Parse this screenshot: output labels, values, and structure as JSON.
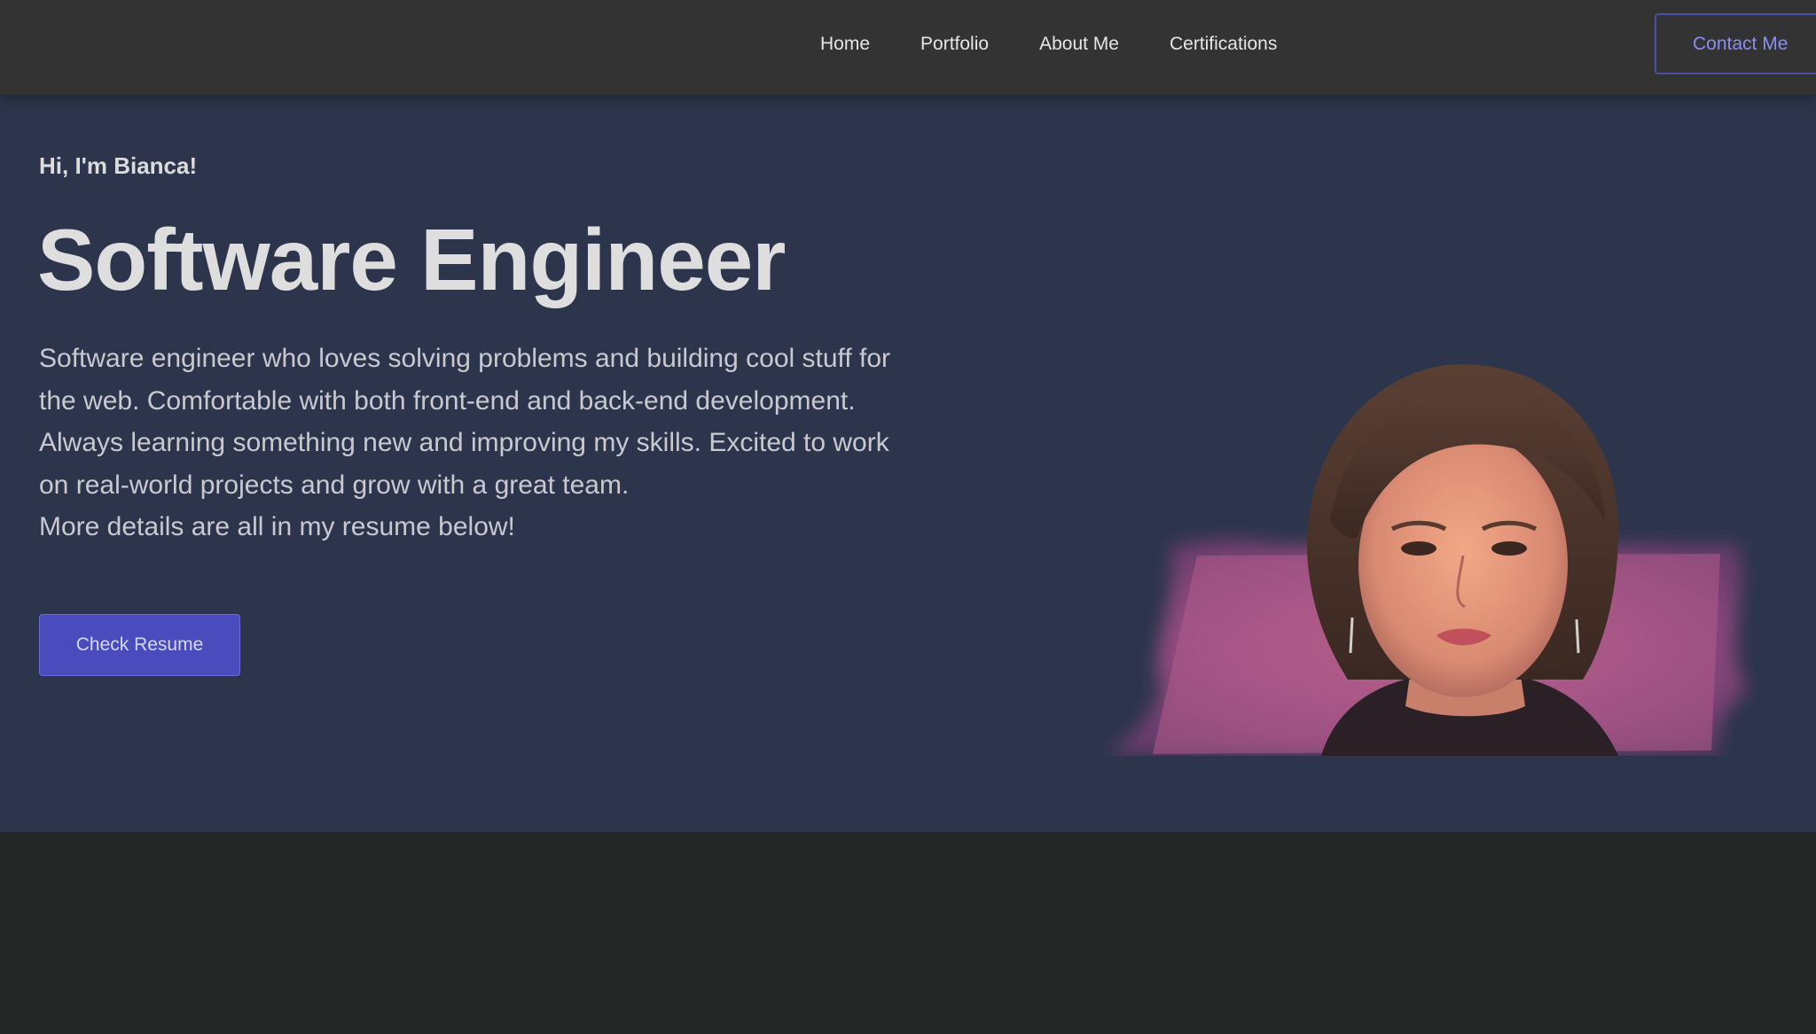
{
  "nav": {
    "links": [
      "Home",
      "Portfolio",
      "About Me",
      "Certifications"
    ],
    "contact_label": "Contact Me"
  },
  "hero": {
    "greeting": "Hi, I'm Bianca!",
    "title": "Software Engineer",
    "description": "Software engineer who loves solving problems and building cool stuff for the web. Comfortable with both front-end and back-end development. Always learning something new and improving my skills. Excited to work on real-world projects and grow with a great team.",
    "description_extra": "More details are all in my resume below!",
    "resume_label": "Check Resume"
  },
  "colors": {
    "navbar": "#333333",
    "hero_background": "#2d354c",
    "page_background": "#252726",
    "accent": "#4a4bbd",
    "contact_text": "#8a8ef0"
  }
}
